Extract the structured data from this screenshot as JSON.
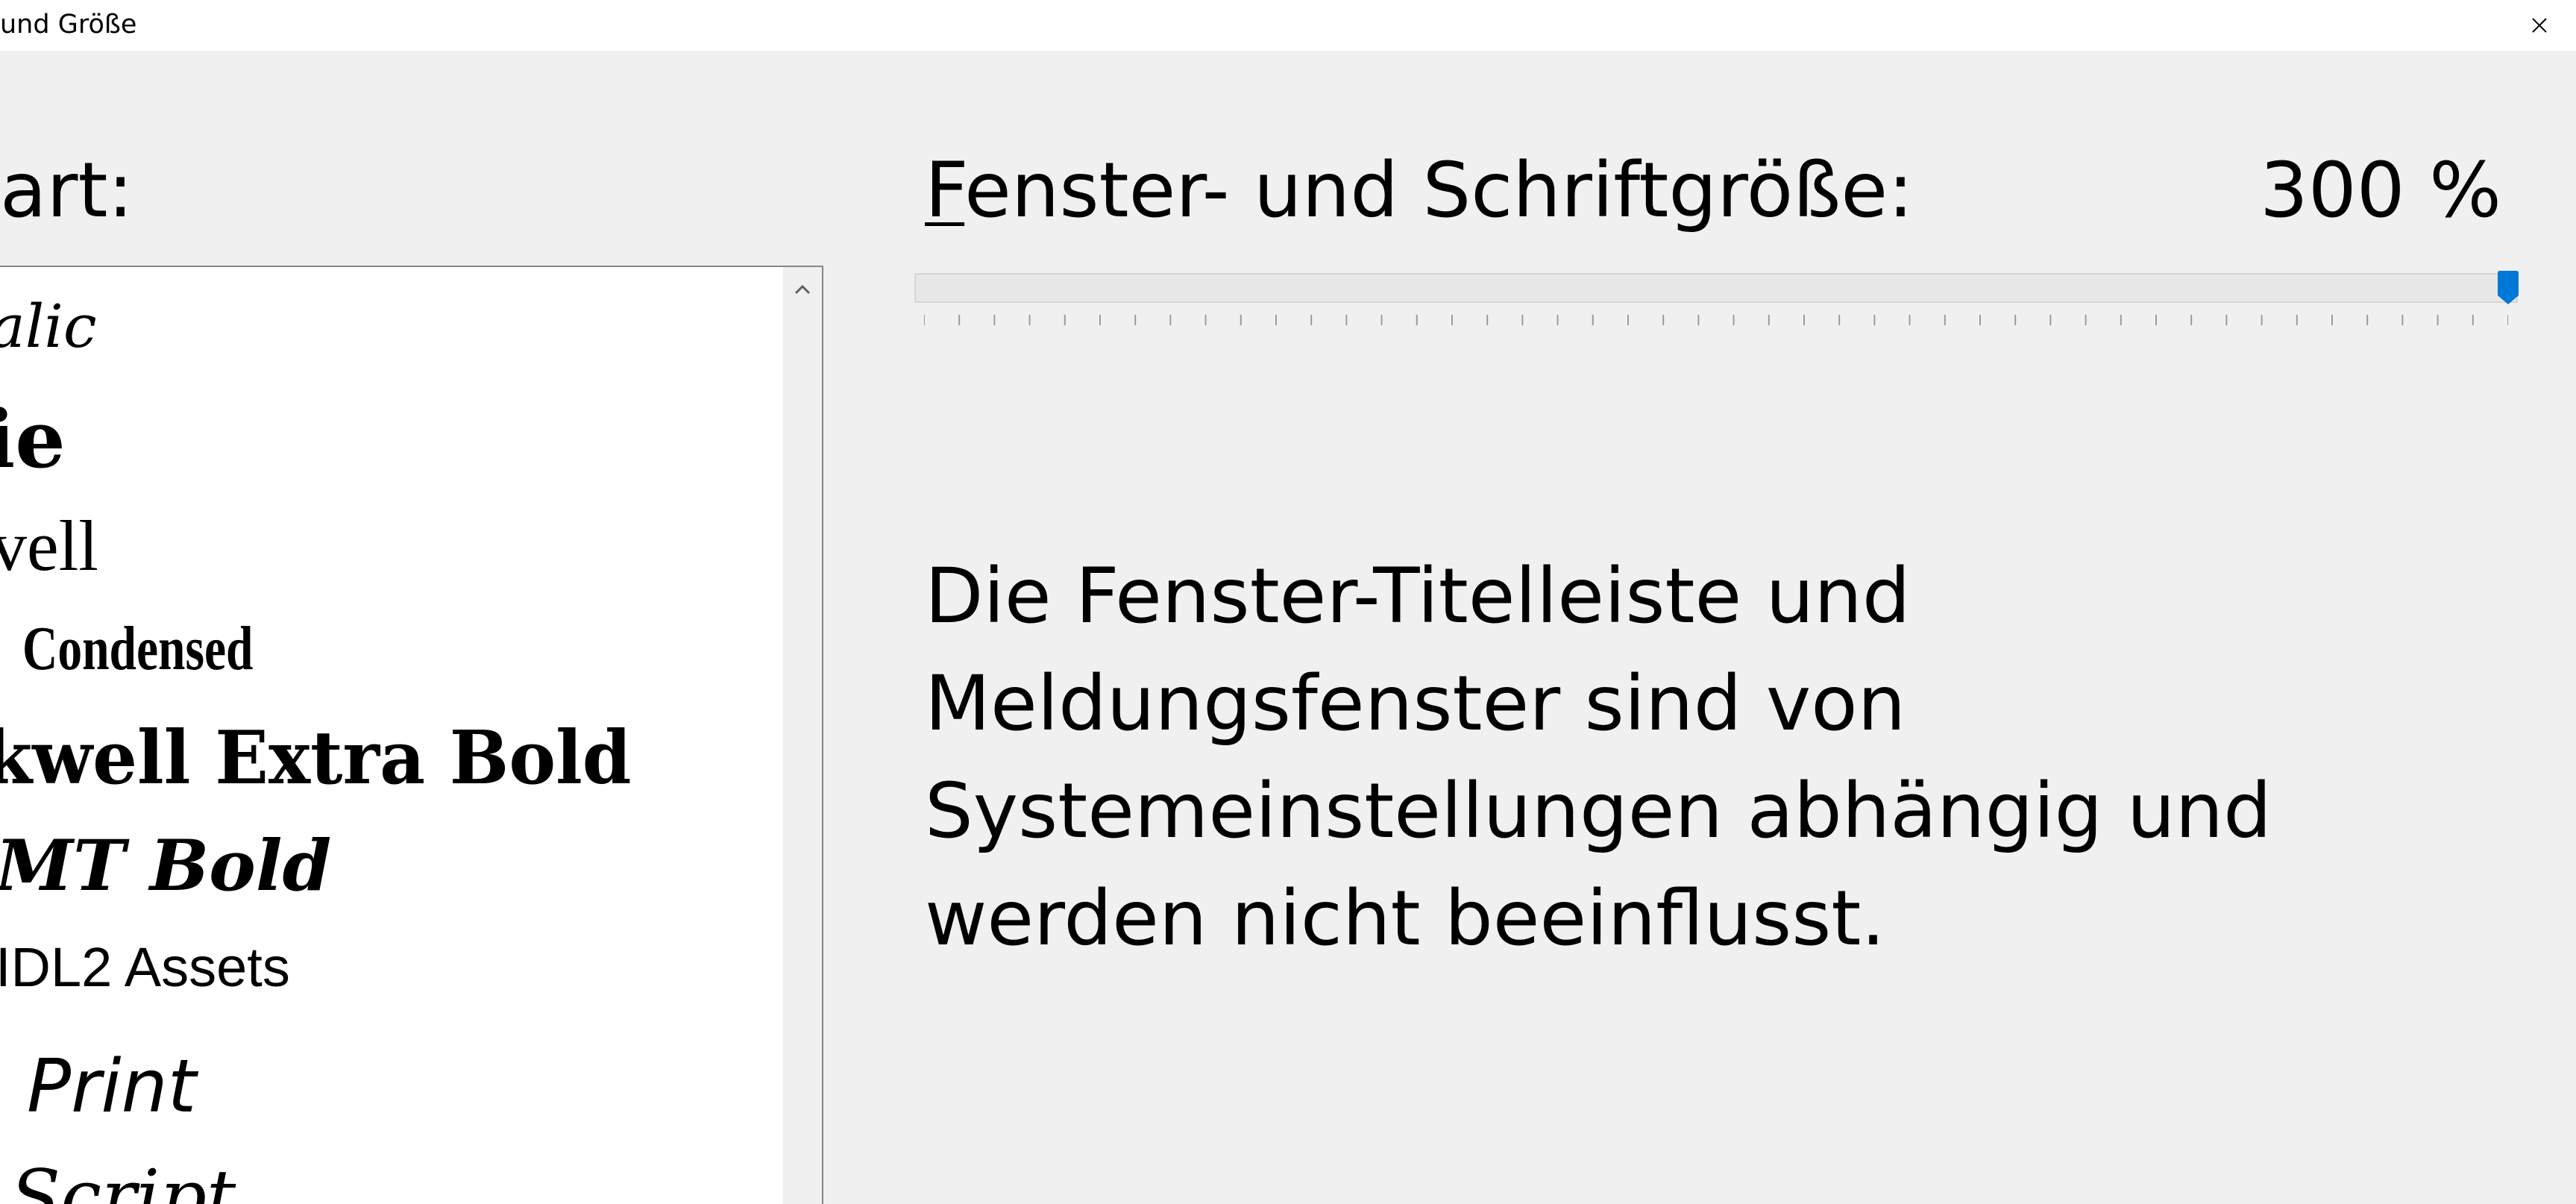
{
  "window": {
    "title": "und Größe",
    "close_icon": "close-icon"
  },
  "left_panel": {
    "label": "art:",
    "font_items": [
      {
        "label": "alic",
        "icon": null
      },
      {
        "label": "ie"
      },
      {
        "label": "vell"
      },
      {
        "label": "Condensed"
      },
      {
        "label": "kwell Extra Bold"
      },
      {
        "label": "MT Bold"
      },
      {
        "label": "IDL2 Assets"
      },
      {
        "label": "Print"
      },
      {
        "label": "Script"
      }
    ]
  },
  "size_setting": {
    "label_accel": "F",
    "label_rest": "enster- und Schriftgröße:",
    "value_text": "300 %",
    "slider_value_fraction": 1.0
  },
  "info": {
    "text": "Die Fenster-Titelleiste und Meldungsfenster sind von Systemeinstellungen abhängig und werden nicht beeinflusst."
  },
  "colors": {
    "background": "#f0f0f0",
    "accent": "#0078d7",
    "list_border": "#828790"
  }
}
